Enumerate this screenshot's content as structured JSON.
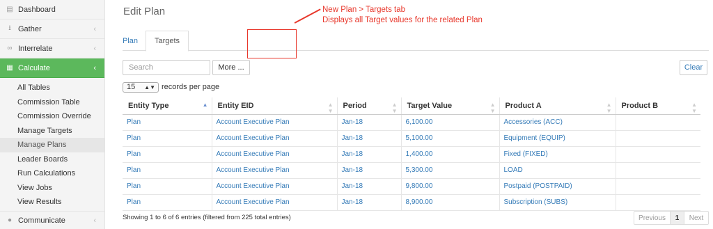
{
  "sidebar": {
    "items": [
      {
        "label": "Dashboard",
        "icon": "bar-chart-icon"
      },
      {
        "label": "Gather",
        "icon": "download-icon"
      },
      {
        "label": "Interrelate",
        "icon": "link-icon"
      },
      {
        "label": "Calculate",
        "icon": "table-icon"
      }
    ],
    "submenu": [
      "All Tables",
      "Commission Table",
      "Commission Override",
      "Manage Targets",
      "Manage Plans",
      "Leader Boards",
      "Run Calculations",
      "View Jobs",
      "View Results"
    ],
    "bottom_item": {
      "label": "Communicate",
      "icon": "comments-icon"
    },
    "active_color": "#5cb85c"
  },
  "page": {
    "title": "Edit Plan"
  },
  "annotation": {
    "line1": "New Plan > Targets tab",
    "line2": "Displays all Target values for the related Plan",
    "color": "#e8372b"
  },
  "tabs": [
    {
      "label": "Plan"
    },
    {
      "label": "Targets"
    }
  ],
  "toolbar": {
    "search_placeholder": "Search",
    "more_label": "More ...",
    "clear_label": "Clear"
  },
  "length": {
    "value": "15",
    "label": "records per page"
  },
  "table": {
    "columns": [
      "Entity Type",
      "Entity EID",
      "Period",
      "Target Value",
      "Product A",
      "Product B"
    ],
    "rows": [
      [
        "Plan",
        "Account Executive Plan",
        "Jan-18",
        "6,100.00",
        "Accessories (ACC)",
        ""
      ],
      [
        "Plan",
        "Account Executive Plan",
        "Jan-18",
        "5,100.00",
        "Equipment (EQUIP)",
        ""
      ],
      [
        "Plan",
        "Account Executive Plan",
        "Jan-18",
        "1,400.00",
        "Fixed (FIXED)",
        ""
      ],
      [
        "Plan",
        "Account Executive Plan",
        "Jan-18",
        "5,300.00",
        "LOAD",
        ""
      ],
      [
        "Plan",
        "Account Executive Plan",
        "Jan-18",
        "9,800.00",
        "Postpaid (POSTPAID)",
        ""
      ],
      [
        "Plan",
        "Account Executive Plan",
        "Jan-18",
        "8,900.00",
        "Subscription (SUBS)",
        ""
      ]
    ]
  },
  "footer": {
    "info": "Showing 1 to 6 of 6 entries (filtered from 225 total entries)",
    "prev_label": "Previous",
    "page": "1",
    "next_label": "Next"
  }
}
